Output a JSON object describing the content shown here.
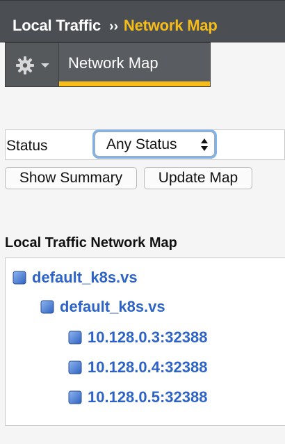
{
  "header": {
    "breadcrumb_section": "Local Traffic",
    "breadcrumb_separator": "››",
    "breadcrumb_current": "Network Map"
  },
  "tabs": {
    "gear_menu_icon": "gear-icon",
    "active_tab_label": "Network Map"
  },
  "filter": {
    "status_label": "Status",
    "status_selected": "Any Status"
  },
  "buttons": {
    "show_summary": "Show Summary",
    "update_map": "Update Map"
  },
  "map": {
    "title": "Local Traffic Network Map",
    "virtual_server": "default_k8s.vs",
    "pool": "default_k8s.vs",
    "members": [
      "10.128.0.3:32388",
      "10.128.0.4:32388",
      "10.128.0.5:32388"
    ]
  },
  "colors": {
    "header_bg": "#4b4e52",
    "accent_yellow": "#f6bd19",
    "link_blue": "#2d63c7",
    "node_blue": "#4a7fd6"
  }
}
